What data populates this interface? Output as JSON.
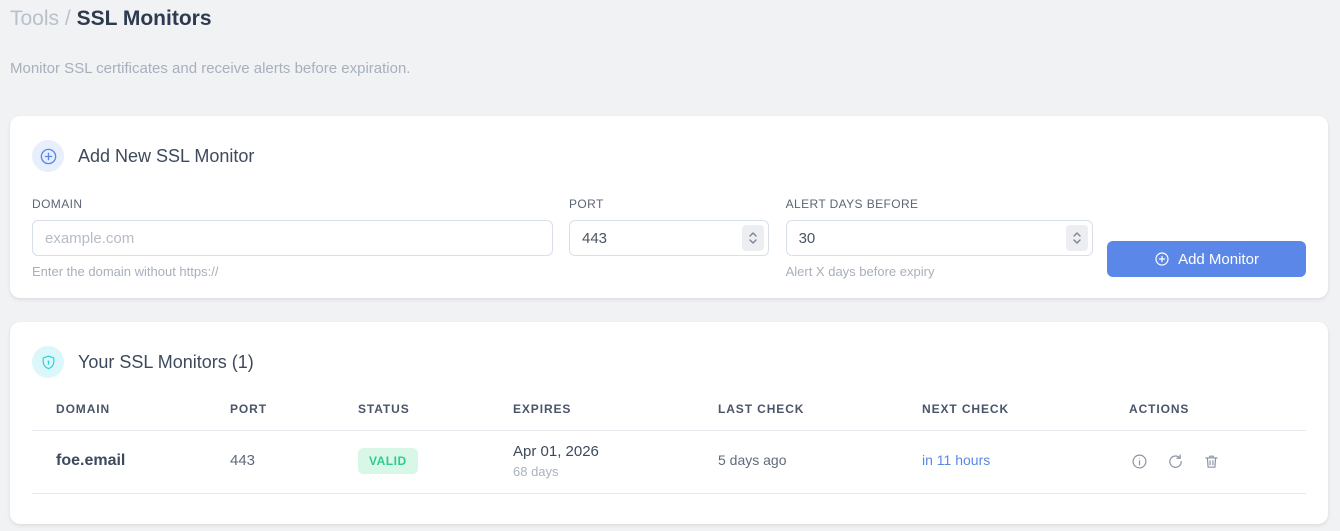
{
  "breadcrumb": {
    "section": "Tools",
    "separator": "/",
    "current": "SSL Monitors"
  },
  "subtitle": "Monitor SSL certificates and receive alerts before expiration.",
  "add_monitor": {
    "title": "Add New SSL Monitor",
    "header_icon": "plus-circle-icon",
    "fields": {
      "domain": {
        "label": "DOMAIN",
        "placeholder": "example.com",
        "value": "",
        "helper": "Enter the domain without https://"
      },
      "port": {
        "label": "PORT",
        "value": "443"
      },
      "alert_days": {
        "label": "ALERT DAYS BEFORE",
        "value": "30",
        "helper": "Alert X days before expiry"
      }
    },
    "submit_label": "Add Monitor",
    "submit_icon": "plus-circle-icon"
  },
  "monitors": {
    "title": "Your SSL Monitors (1)",
    "count": 1,
    "header_icon": "shield-icon",
    "columns": [
      "DOMAIN",
      "PORT",
      "STATUS",
      "EXPIRES",
      "LAST CHECK",
      "NEXT CHECK",
      "ACTIONS"
    ],
    "rows": [
      {
        "domain": "foe.email",
        "port": "443",
        "status": "VALID",
        "expires_date": "Apr 01, 2026",
        "expires_in": "68 days",
        "last_check": "5 days ago",
        "next_check": "in 11 hours",
        "actions": [
          "info-icon",
          "refresh-icon",
          "trash-icon"
        ]
      }
    ]
  },
  "colors": {
    "accent_blue": "#5b87e8",
    "accent_cyan": "#30d3de",
    "status_valid_bg": "#d8f7e7",
    "status_valid_text": "#2fcb8e",
    "page_background": "#f0f2f4"
  }
}
